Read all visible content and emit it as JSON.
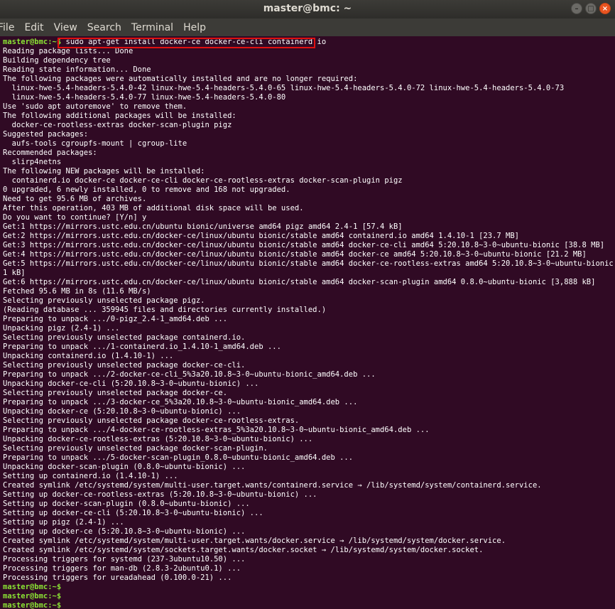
{
  "window": {
    "title": "master@bmc: ~",
    "buttons": [
      "minimize",
      "maximize",
      "close"
    ]
  },
  "menu": [
    "File",
    "Edit",
    "View",
    "Search",
    "Terminal",
    "Help"
  ],
  "colors": {
    "background": "#300a24",
    "prompt": "#8ae234",
    "text": "#ffffff",
    "highlight_box": "#e01010"
  },
  "terminal": {
    "prompt": "master@bmc:~$",
    "command": " sudo apt-get install docker-ce docker-ce-cli containerd.io",
    "output": [
      "Reading package lists... Done",
      "Building dependency tree",
      "Reading state information... Done",
      "The following packages were automatically installed and are no longer required:",
      "  linux-hwe-5.4-headers-5.4.0-42 linux-hwe-5.4-headers-5.4.0-65 linux-hwe-5.4-headers-5.4.0-72 linux-hwe-5.4-headers-5.4.0-73",
      "  linux-hwe-5.4-headers-5.4.0-77 linux-hwe-5.4-headers-5.4.0-80",
      "Use 'sudo apt autoremove' to remove them.",
      "The following additional packages will be installed:",
      "  docker-ce-rootless-extras docker-scan-plugin pigz",
      "Suggested packages:",
      "  aufs-tools cgroupfs-mount | cgroup-lite",
      "Recommended packages:",
      "  slirp4netns",
      "The following NEW packages will be installed:",
      "  containerd.io docker-ce docker-ce-cli docker-ce-rootless-extras docker-scan-plugin pigz",
      "0 upgraded, 6 newly installed, 0 to remove and 168 not upgraded.",
      "Need to get 95.6 MB of archives.",
      "After this operation, 403 MB of additional disk space will be used.",
      "Do you want to continue? [Y/n] y",
      "Get:1 https://mirrors.ustc.edu.cn/ubuntu bionic/universe amd64 pigz amd64 2.4-1 [57.4 kB]",
      "Get:2 https://mirrors.ustc.edu.cn/docker-ce/linux/ubuntu bionic/stable amd64 containerd.io amd64 1.4.10-1 [23.7 MB]",
      "Get:3 https://mirrors.ustc.edu.cn/docker-ce/linux/ubuntu bionic/stable amd64 docker-ce-cli amd64 5:20.10.8~3-0~ubuntu-bionic [38.8 MB]",
      "Get:4 https://mirrors.ustc.edu.cn/docker-ce/linux/ubuntu bionic/stable amd64 docker-ce amd64 5:20.10.8~3-0~ubuntu-bionic [21.2 MB]",
      "Get:5 https://mirrors.ustc.edu.cn/docker-ce/linux/ubuntu bionic/stable amd64 docker-ce-rootless-extras amd64 5:20.10.8~3-0~ubuntu-bionic [7,91",
      "1 kB]",
      "Get:6 https://mirrors.ustc.edu.cn/docker-ce/linux/ubuntu bionic/stable amd64 docker-scan-plugin amd64 0.8.0~ubuntu-bionic [3,888 kB]",
      "Fetched 95.6 MB in 8s (11.6 MB/s)",
      "Selecting previously unselected package pigz.",
      "(Reading database ... 359945 files and directories currently installed.)",
      "Preparing to unpack .../0-pigz_2.4-1_amd64.deb ...",
      "Unpacking pigz (2.4-1) ...",
      "Selecting previously unselected package containerd.io.",
      "Preparing to unpack .../1-containerd.io_1.4.10-1_amd64.deb ...",
      "Unpacking containerd.io (1.4.10-1) ...",
      "Selecting previously unselected package docker-ce-cli.",
      "Preparing to unpack .../2-docker-ce-cli_5%3a20.10.8~3-0~ubuntu-bionic_amd64.deb ...",
      "Unpacking docker-ce-cli (5:20.10.8~3-0~ubuntu-bionic) ...",
      "Selecting previously unselected package docker-ce.",
      "Preparing to unpack .../3-docker-ce_5%3a20.10.8~3-0~ubuntu-bionic_amd64.deb ...",
      "Unpacking docker-ce (5:20.10.8~3-0~ubuntu-bionic) ...",
      "Selecting previously unselected package docker-ce-rootless-extras.",
      "Preparing to unpack .../4-docker-ce-rootless-extras_5%3a20.10.8~3-0~ubuntu-bionic_amd64.deb ...",
      "Unpacking docker-ce-rootless-extras (5:20.10.8~3-0~ubuntu-bionic) ...",
      "Selecting previously unselected package docker-scan-plugin.",
      "Preparing to unpack .../5-docker-scan-plugin_0.8.0~ubuntu-bionic_amd64.deb ...",
      "Unpacking docker-scan-plugin (0.8.0~ubuntu-bionic) ...",
      "Setting up containerd.io (1.4.10-1) ...",
      "Created symlink /etc/systemd/system/multi-user.target.wants/containerd.service → /lib/systemd/system/containerd.service.",
      "Setting up docker-ce-rootless-extras (5:20.10.8~3-0~ubuntu-bionic) ...",
      "Setting up docker-scan-plugin (0.8.0~ubuntu-bionic) ...",
      "Setting up docker-ce-cli (5:20.10.8~3-0~ubuntu-bionic) ...",
      "Setting up pigz (2.4-1) ...",
      "Setting up docker-ce (5:20.10.8~3-0~ubuntu-bionic) ...",
      "Created symlink /etc/systemd/system/multi-user.target.wants/docker.service → /lib/systemd/system/docker.service.",
      "Created symlink /etc/systemd/system/sockets.target.wants/docker.socket → /lib/systemd/system/docker.socket.",
      "Processing triggers for systemd (237-3ubuntu10.50) ...",
      "Processing triggers for man-db (2.8.3-2ubuntu0.1) ...",
      "Processing triggers for ureadahead (0.100.0-21) ..."
    ],
    "trailing_prompts": [
      "master@bmc:~$",
      "master@bmc:~$",
      "master@bmc:~$"
    ]
  }
}
